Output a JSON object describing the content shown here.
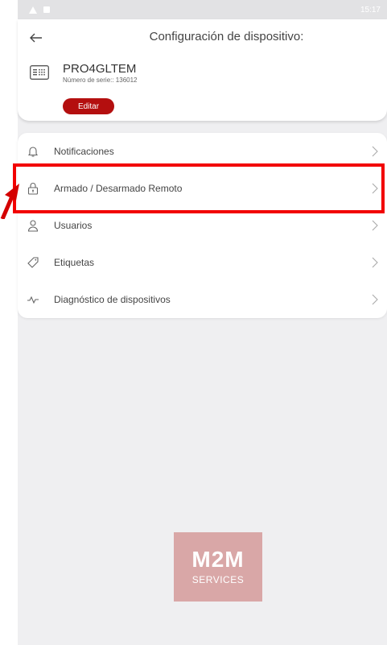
{
  "status_bar": {
    "time": "15:17"
  },
  "header": {
    "title": "Configuración de dispositivo:"
  },
  "device": {
    "name": "PRO4GLTEM",
    "serial": "Número de serie:: 136012",
    "edit_label": "Editar"
  },
  "menu": {
    "items": [
      {
        "label": "Notificaciones",
        "icon": "bell-icon"
      },
      {
        "label": "Armado / Desarmado Remoto",
        "icon": "lock-icon"
      },
      {
        "label": "Usuarios",
        "icon": "user-icon"
      },
      {
        "label": "Etiquetas",
        "icon": "tag-icon"
      },
      {
        "label": "Diagnóstico de dispositivos",
        "icon": "pulse-icon"
      }
    ]
  },
  "logo": {
    "main": "M2M",
    "sub": "SERVICES"
  },
  "colors": {
    "accent": "#b40f0f",
    "highlight": "#f20000",
    "background": "#efeff1",
    "logo_bg": "#d9a7a7"
  }
}
